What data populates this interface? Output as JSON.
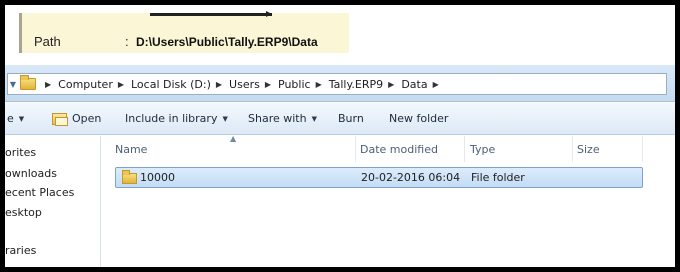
{
  "path_box": {
    "label": "Path",
    "separator": ":",
    "value": "D:\\Users\\Public\\Tally.ERP9\\Data"
  },
  "address_bar": {
    "crumbs": [
      "Computer",
      "Local Disk (D:)",
      "Users",
      "Public",
      "Tally.ERP9",
      "Data"
    ]
  },
  "toolbar": {
    "organize_partial": "e",
    "open_label": "Open",
    "include_label": "Include in library",
    "share_label": "Share with",
    "burn_label": "Burn",
    "new_folder_label": "New folder"
  },
  "nav_pane": {
    "items": [
      "orites",
      "ownloads",
      "ecent Places",
      "esktop",
      "raries"
    ]
  },
  "columns": {
    "name": "Name",
    "date": "Date modified",
    "type": "Type",
    "size": "Size"
  },
  "files": [
    {
      "name": "10000",
      "date": "20-02-2016 06:04",
      "type": "File folder",
      "size": ""
    }
  ],
  "colors": {
    "path_bg": "#fbf6d6",
    "selection": "#c3dcf5",
    "toolbar": "#dde9f6"
  }
}
